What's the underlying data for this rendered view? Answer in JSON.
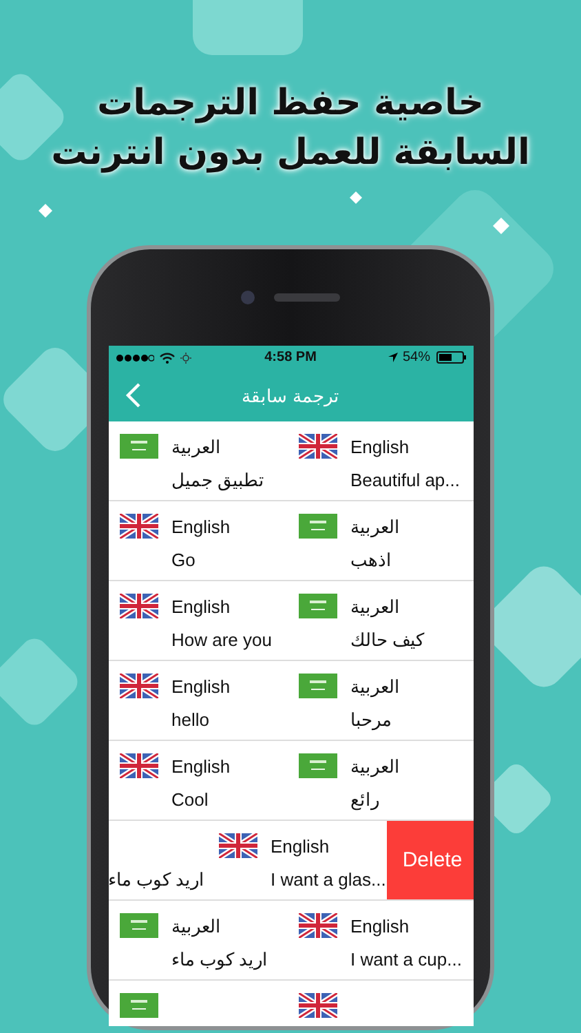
{
  "headline": [
    "خاصية حفظ الترجمات",
    "السابقة للعمل بدون انترنت"
  ],
  "status_bar": {
    "time": "4:58 PM",
    "battery": "54%"
  },
  "nav": {
    "title": "ترجمة سابقة"
  },
  "rows": [
    {
      "swiped": false,
      "left": {
        "kind": "arabic",
        "language": "العربية",
        "text": "تطبيق جميل"
      },
      "right": {
        "kind": "english",
        "language": "English",
        "text": "Beautiful ap..."
      }
    },
    {
      "swiped": false,
      "left": {
        "kind": "english",
        "language": "English",
        "text": "Go"
      },
      "right": {
        "kind": "arabic",
        "language": "العربية",
        "text": "اذهب"
      }
    },
    {
      "swiped": false,
      "left": {
        "kind": "english",
        "language": "English",
        "text": "How are you"
      },
      "right": {
        "kind": "arabic",
        "language": "العربية",
        "text": "كيف حالك"
      }
    },
    {
      "swiped": false,
      "left": {
        "kind": "english",
        "language": "English",
        "text": "hello"
      },
      "right": {
        "kind": "arabic",
        "language": "العربية",
        "text": "مرحبا"
      }
    },
    {
      "swiped": false,
      "left": {
        "kind": "english",
        "language": "English",
        "text": "Cool"
      },
      "right": {
        "kind": "arabic",
        "language": "العربية",
        "text": "رائع"
      }
    },
    {
      "swiped": true,
      "delete_label": "Delete",
      "left": {
        "text": "اريد كوب ماء"
      },
      "right": {
        "kind": "english",
        "language": "English",
        "text": "I want a glas..."
      }
    },
    {
      "swiped": false,
      "left": {
        "kind": "arabic",
        "language": "العربية",
        "text": "اريد كوب ماء"
      },
      "right": {
        "kind": "english",
        "language": "English",
        "text": "I want a cup..."
      }
    },
    {
      "swiped": false,
      "left": {
        "kind": "arabic"
      },
      "right": {
        "kind": "english"
      }
    }
  ]
}
